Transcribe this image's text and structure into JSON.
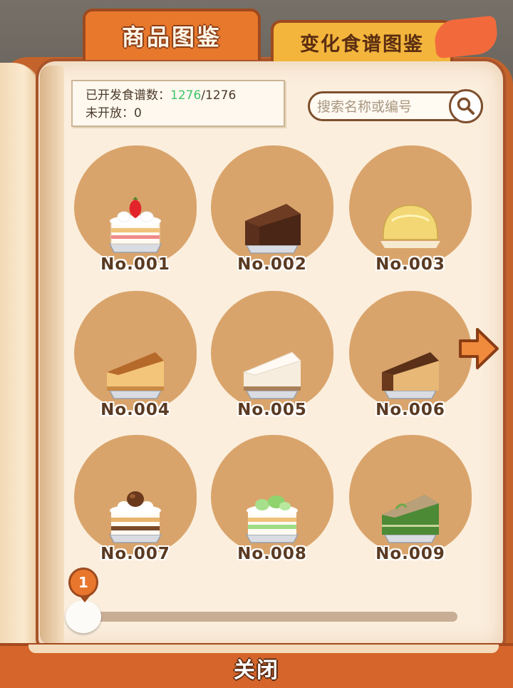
{
  "tabs": {
    "catalog": "商品图鉴",
    "variation": "变化食谱图鉴"
  },
  "stats": {
    "opened_label": "已开发食谱数：",
    "opened_count": "1276",
    "opened_total": "/1276",
    "unopened_label": "未开放：",
    "unopened_count": "0"
  },
  "search": {
    "placeholder": "搜索名称或编号"
  },
  "items": [
    {
      "label": "No.001",
      "icon": "strawberry-shortcake"
    },
    {
      "label": "No.002",
      "icon": "chocolate-cake"
    },
    {
      "label": "No.003",
      "icon": "custard-pudding"
    },
    {
      "label": "No.004",
      "icon": "baked-cheesecake"
    },
    {
      "label": "No.005",
      "icon": "rare-cheesecake"
    },
    {
      "label": "No.006",
      "icon": "dark-baked-cheesecake"
    },
    {
      "label": "No.007",
      "icon": "chestnut-shortcake"
    },
    {
      "label": "No.008",
      "icon": "melon-shortcake"
    },
    {
      "label": "No.009",
      "icon": "matcha-cake"
    }
  ],
  "pager": {
    "current_page": "1"
  },
  "close_label": "关闭",
  "colors": {
    "tab_active": "#e8782c",
    "tab_inactive": "#f3b53c",
    "book_frame": "#a9542a",
    "item_bg": "#d9a46b",
    "highlight": "#3ec46a"
  }
}
